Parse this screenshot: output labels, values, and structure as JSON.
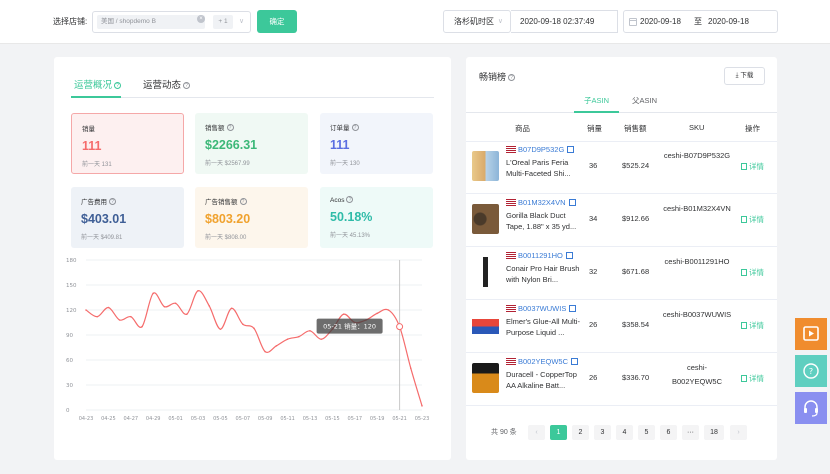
{
  "topbar": {
    "store_label": "选择店铺:",
    "store_tag": "美国 / shopdemo B",
    "store_more": "+ 1",
    "confirm_label": "确定",
    "timezone": "洛杉矶时区",
    "current_time": "2020-09-18 02:37:49",
    "date_start": "2020-09-18",
    "date_sep": "至",
    "date_end": "2020-09-18"
  },
  "overview": {
    "tab_ops": "运营概况",
    "tab_activity": "运营动态",
    "metrics": [
      {
        "label": "销量",
        "value": "111",
        "prev": "前一天 131",
        "color": "#f56c6c",
        "bg": "#fdf0f0"
      },
      {
        "label": "销售额",
        "value": "$2266.31",
        "prev": "前一天 $2567.99",
        "color": "#3cb878",
        "bg": "#f0f9f4"
      },
      {
        "label": "订单量",
        "value": "111",
        "prev": "前一天 130",
        "color": "#5b6ee1",
        "bg": "#f2f5fb"
      },
      {
        "label": "广告费用",
        "value": "$403.01",
        "prev": "前一天 $409.81",
        "color": "#3f5f96",
        "bg": "#eef2f7"
      },
      {
        "label": "广告销售额",
        "value": "$803.20",
        "prev": "前一天 $808.00",
        "color": "#f0a22e",
        "bg": "#fdf6ec"
      },
      {
        "label": "Acos",
        "value": "50.18%",
        "prev": "前一天 45.13%",
        "color": "#2fbba8",
        "bg": "#eefaf8"
      }
    ]
  },
  "chart_data": {
    "type": "line",
    "x": [
      "04-23",
      "04-24",
      "04-25",
      "04-26",
      "04-27",
      "04-28",
      "04-29",
      "04-30",
      "05-01",
      "05-02",
      "05-03",
      "05-04",
      "05-05",
      "05-06",
      "05-07",
      "05-08",
      "05-09",
      "05-10",
      "05-11",
      "05-12",
      "05-13",
      "05-14",
      "05-15",
      "05-16",
      "05-17",
      "05-18",
      "05-19",
      "05-20",
      "05-21",
      "05-22",
      "05-23"
    ],
    "x_ticks": [
      "04-23",
      "04-25",
      "04-27",
      "04-29",
      "05-01",
      "05-03",
      "05-05",
      "05-07",
      "05-09",
      "05-11",
      "05-13",
      "05-15",
      "05-17",
      "05-19",
      "05-21",
      "05-23"
    ],
    "y": [
      120,
      112,
      123,
      108,
      112,
      100,
      140,
      124,
      128,
      115,
      143,
      125,
      97,
      122,
      103,
      98,
      70,
      77,
      85,
      88,
      95,
      85,
      97,
      115,
      105,
      108,
      116,
      120,
      100,
      50,
      5
    ],
    "y_ticks": [
      0,
      30,
      60,
      90,
      120,
      150,
      180
    ],
    "ylim": [
      0,
      180
    ],
    "tooltip": "05-21 销量：120",
    "highlight_x": "05-21",
    "color": "#f56c6c"
  },
  "bestsellers": {
    "title": "畅销榜",
    "download": "下载",
    "subtab_child": "子ASIN",
    "subtab_parent": "父ASIN",
    "headers": {
      "product": "商品",
      "qty": "销量",
      "sales": "销售额",
      "sku": "SKU",
      "action": "操作"
    },
    "rows": [
      {
        "asin": "B07D9P532G",
        "name": "L'Oreal Paris Feria Multi-Faceted Shi...",
        "qty": "36",
        "sales": "$525.24",
        "sku": "ceshi-B07D9P532G",
        "action": "详情"
      },
      {
        "asin": "B01M32X4VN",
        "name": "Gorilla Black Duct Tape, 1.88\" x 35 yd...",
        "qty": "34",
        "sales": "$912.66",
        "sku": "ceshi-B01M32X4VN",
        "action": "详情"
      },
      {
        "asin": "B0011291HO",
        "name": "Conair Pro Hair Brush with Nylon Bri...",
        "qty": "32",
        "sales": "$671.68",
        "sku": "ceshi-B0011291HO",
        "action": "详情"
      },
      {
        "asin": "B0037WUWIS",
        "name": "Elmer's Glue-All Multi-Purpose Liquid ...",
        "qty": "26",
        "sales": "$358.54",
        "sku": "ceshi-B0037WUWIS",
        "action": "详情"
      },
      {
        "asin": "B002YEQW5C",
        "name": "Duracell - CopperTop AA Alkaline Batt...",
        "qty": "26",
        "sales": "$336.70",
        "sku": "ceshi-B002YEQW5C",
        "action": "详情"
      }
    ],
    "pager": {
      "total": "共 90 条",
      "pages": [
        "1",
        "2",
        "3",
        "4",
        "5",
        "6",
        "···",
        "18"
      ],
      "active": "1"
    }
  },
  "side_buttons": [
    "play-icon",
    "help-icon",
    "headset-icon"
  ]
}
